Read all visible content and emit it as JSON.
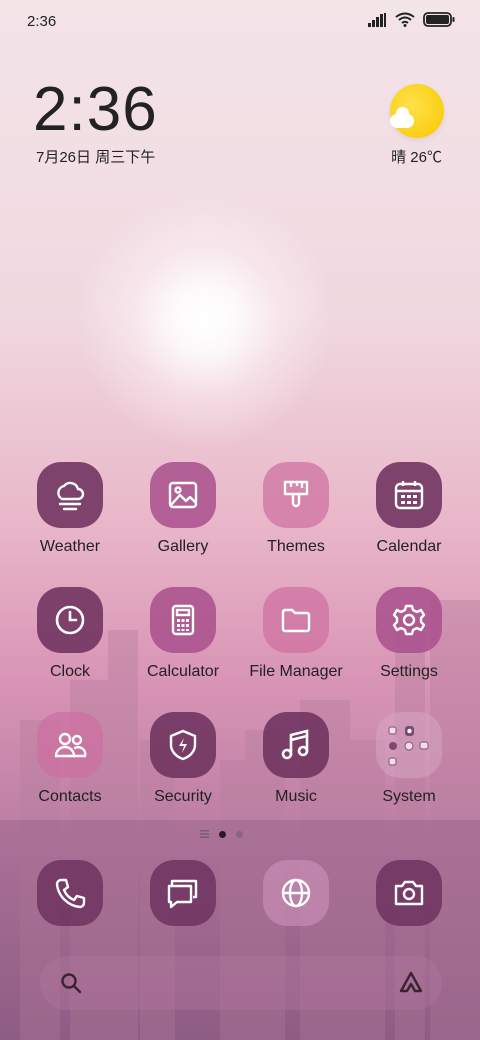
{
  "status_bar": {
    "time": "2:36",
    "icons": [
      "signal-icon",
      "wifi-icon",
      "battery-icon"
    ]
  },
  "clock_widget": {
    "time": "2:36",
    "date": "7月26日 周三下午"
  },
  "weather_widget": {
    "condition_icon": "sun-cloud-icon",
    "text": "晴 26℃"
  },
  "apps": [
    {
      "label": "Weather",
      "icon": "weather-icon"
    },
    {
      "label": "Gallery",
      "icon": "gallery-icon"
    },
    {
      "label": "Themes",
      "icon": "themes-icon"
    },
    {
      "label": "Calendar",
      "icon": "calendar-icon"
    },
    {
      "label": "Clock",
      "icon": "clock-icon"
    },
    {
      "label": "Calculator",
      "icon": "calculator-icon"
    },
    {
      "label": "File Manager",
      "icon": "folder-icon"
    },
    {
      "label": "Settings",
      "icon": "gear-icon"
    },
    {
      "label": "Contacts",
      "icon": "contacts-icon"
    },
    {
      "label": "Security",
      "icon": "shield-icon"
    },
    {
      "label": "Music",
      "icon": "music-icon"
    },
    {
      "label": "System",
      "icon": "folder-grid-icon"
    }
  ],
  "page_indicator": {
    "pages": 2,
    "active": 1
  },
  "dock": [
    {
      "icon": "phone-icon"
    },
    {
      "icon": "messages-icon"
    },
    {
      "icon": "globe-icon"
    },
    {
      "icon": "camera-icon"
    }
  ],
  "search_bar": {
    "left_icon": "search-icon",
    "right_icon": "assistant-icon"
  },
  "colors": {
    "accent": "#9b4a86",
    "text": "#222222"
  }
}
